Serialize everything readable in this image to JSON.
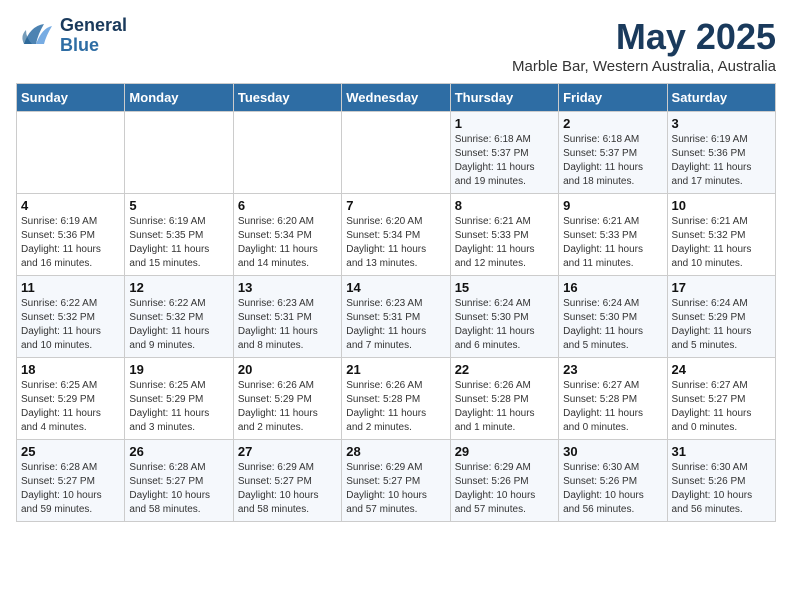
{
  "header": {
    "logo_general": "General",
    "logo_blue": "Blue",
    "month_title": "May 2025",
    "location": "Marble Bar, Western Australia, Australia"
  },
  "days_of_week": [
    "Sunday",
    "Monday",
    "Tuesday",
    "Wednesday",
    "Thursday",
    "Friday",
    "Saturday"
  ],
  "weeks": [
    [
      {
        "day": "",
        "info": ""
      },
      {
        "day": "",
        "info": ""
      },
      {
        "day": "",
        "info": ""
      },
      {
        "day": "",
        "info": ""
      },
      {
        "day": "1",
        "info": "Sunrise: 6:18 AM\nSunset: 5:37 PM\nDaylight: 11 hours\nand 19 minutes."
      },
      {
        "day": "2",
        "info": "Sunrise: 6:18 AM\nSunset: 5:37 PM\nDaylight: 11 hours\nand 18 minutes."
      },
      {
        "day": "3",
        "info": "Sunrise: 6:19 AM\nSunset: 5:36 PM\nDaylight: 11 hours\nand 17 minutes."
      }
    ],
    [
      {
        "day": "4",
        "info": "Sunrise: 6:19 AM\nSunset: 5:36 PM\nDaylight: 11 hours\nand 16 minutes."
      },
      {
        "day": "5",
        "info": "Sunrise: 6:19 AM\nSunset: 5:35 PM\nDaylight: 11 hours\nand 15 minutes."
      },
      {
        "day": "6",
        "info": "Sunrise: 6:20 AM\nSunset: 5:34 PM\nDaylight: 11 hours\nand 14 minutes."
      },
      {
        "day": "7",
        "info": "Sunrise: 6:20 AM\nSunset: 5:34 PM\nDaylight: 11 hours\nand 13 minutes."
      },
      {
        "day": "8",
        "info": "Sunrise: 6:21 AM\nSunset: 5:33 PM\nDaylight: 11 hours\nand 12 minutes."
      },
      {
        "day": "9",
        "info": "Sunrise: 6:21 AM\nSunset: 5:33 PM\nDaylight: 11 hours\nand 11 minutes."
      },
      {
        "day": "10",
        "info": "Sunrise: 6:21 AM\nSunset: 5:32 PM\nDaylight: 11 hours\nand 10 minutes."
      }
    ],
    [
      {
        "day": "11",
        "info": "Sunrise: 6:22 AM\nSunset: 5:32 PM\nDaylight: 11 hours\nand 10 minutes."
      },
      {
        "day": "12",
        "info": "Sunrise: 6:22 AM\nSunset: 5:32 PM\nDaylight: 11 hours\nand 9 minutes."
      },
      {
        "day": "13",
        "info": "Sunrise: 6:23 AM\nSunset: 5:31 PM\nDaylight: 11 hours\nand 8 minutes."
      },
      {
        "day": "14",
        "info": "Sunrise: 6:23 AM\nSunset: 5:31 PM\nDaylight: 11 hours\nand 7 minutes."
      },
      {
        "day": "15",
        "info": "Sunrise: 6:24 AM\nSunset: 5:30 PM\nDaylight: 11 hours\nand 6 minutes."
      },
      {
        "day": "16",
        "info": "Sunrise: 6:24 AM\nSunset: 5:30 PM\nDaylight: 11 hours\nand 5 minutes."
      },
      {
        "day": "17",
        "info": "Sunrise: 6:24 AM\nSunset: 5:29 PM\nDaylight: 11 hours\nand 5 minutes."
      }
    ],
    [
      {
        "day": "18",
        "info": "Sunrise: 6:25 AM\nSunset: 5:29 PM\nDaylight: 11 hours\nand 4 minutes."
      },
      {
        "day": "19",
        "info": "Sunrise: 6:25 AM\nSunset: 5:29 PM\nDaylight: 11 hours\nand 3 minutes."
      },
      {
        "day": "20",
        "info": "Sunrise: 6:26 AM\nSunset: 5:29 PM\nDaylight: 11 hours\nand 2 minutes."
      },
      {
        "day": "21",
        "info": "Sunrise: 6:26 AM\nSunset: 5:28 PM\nDaylight: 11 hours\nand 2 minutes."
      },
      {
        "day": "22",
        "info": "Sunrise: 6:26 AM\nSunset: 5:28 PM\nDaylight: 11 hours\nand 1 minute."
      },
      {
        "day": "23",
        "info": "Sunrise: 6:27 AM\nSunset: 5:28 PM\nDaylight: 11 hours\nand 0 minutes."
      },
      {
        "day": "24",
        "info": "Sunrise: 6:27 AM\nSunset: 5:27 PM\nDaylight: 11 hours\nand 0 minutes."
      }
    ],
    [
      {
        "day": "25",
        "info": "Sunrise: 6:28 AM\nSunset: 5:27 PM\nDaylight: 10 hours\nand 59 minutes."
      },
      {
        "day": "26",
        "info": "Sunrise: 6:28 AM\nSunset: 5:27 PM\nDaylight: 10 hours\nand 58 minutes."
      },
      {
        "day": "27",
        "info": "Sunrise: 6:29 AM\nSunset: 5:27 PM\nDaylight: 10 hours\nand 58 minutes."
      },
      {
        "day": "28",
        "info": "Sunrise: 6:29 AM\nSunset: 5:27 PM\nDaylight: 10 hours\nand 57 minutes."
      },
      {
        "day": "29",
        "info": "Sunrise: 6:29 AM\nSunset: 5:26 PM\nDaylight: 10 hours\nand 57 minutes."
      },
      {
        "day": "30",
        "info": "Sunrise: 6:30 AM\nSunset: 5:26 PM\nDaylight: 10 hours\nand 56 minutes."
      },
      {
        "day": "31",
        "info": "Sunrise: 6:30 AM\nSunset: 5:26 PM\nDaylight: 10 hours\nand 56 minutes."
      }
    ]
  ]
}
